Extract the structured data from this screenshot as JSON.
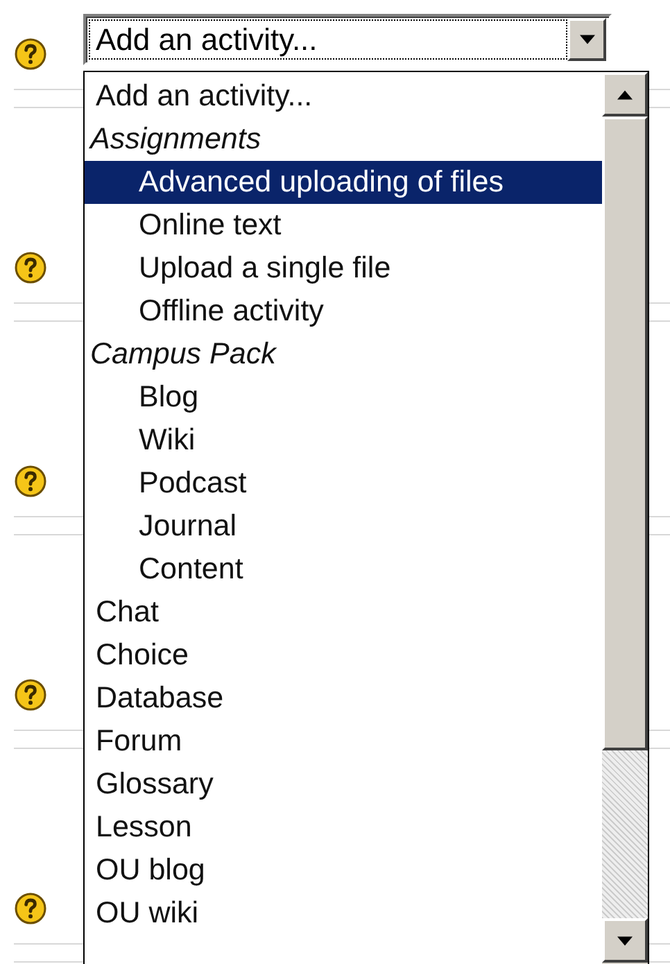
{
  "select": {
    "value": "Add an activity..."
  },
  "options": [
    {
      "kind": "option",
      "label": "Add an activity...",
      "selected": false
    },
    {
      "kind": "group",
      "label": "Assignments",
      "children": [
        {
          "label": "Advanced uploading of files",
          "selected": true
        },
        {
          "label": "Online text",
          "selected": false
        },
        {
          "label": "Upload a single file",
          "selected": false
        },
        {
          "label": "Offline activity",
          "selected": false
        }
      ]
    },
    {
      "kind": "group",
      "label": "Campus Pack",
      "children": [
        {
          "label": "Blog",
          "selected": false
        },
        {
          "label": "Wiki",
          "selected": false
        },
        {
          "label": "Podcast",
          "selected": false
        },
        {
          "label": "Journal",
          "selected": false
        },
        {
          "label": "Content",
          "selected": false
        }
      ]
    },
    {
      "kind": "option",
      "label": "Chat",
      "selected": false
    },
    {
      "kind": "option",
      "label": "Choice",
      "selected": false
    },
    {
      "kind": "option",
      "label": "Database",
      "selected": false
    },
    {
      "kind": "option",
      "label": "Forum",
      "selected": false
    },
    {
      "kind": "option",
      "label": "Glossary",
      "selected": false
    },
    {
      "kind": "option",
      "label": "Lesson",
      "selected": false
    },
    {
      "kind": "option",
      "label": "OU blog",
      "selected": false
    },
    {
      "kind": "option",
      "label": "OU wiki",
      "selected": false
    }
  ]
}
